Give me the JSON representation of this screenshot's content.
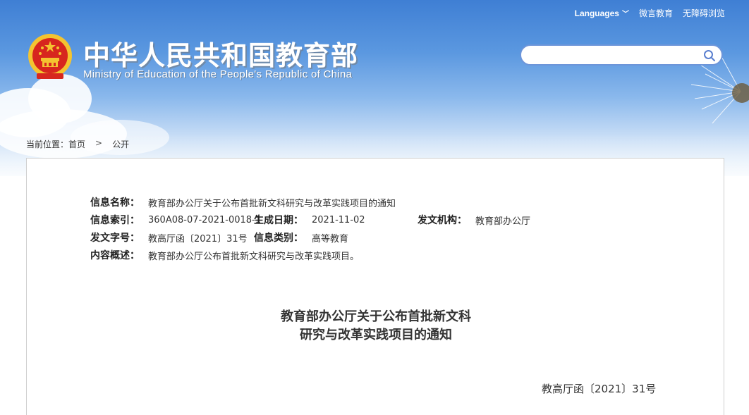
{
  "header": {
    "title_cn": "中华人民共和国教育部",
    "title_en": "Ministry of Education of the People's Republic of China",
    "links": {
      "languages": "Languages",
      "weiyan": "微言教育",
      "accessible": "无障碍浏览"
    },
    "search": {
      "placeholder": "",
      "value": ""
    }
  },
  "breadcrumb": {
    "prefix": "当前位置：",
    "home": "首页",
    "separator": ">",
    "current": "公开"
  },
  "meta": {
    "name_label": "信息名称：",
    "name_value": "教育部办公厅关于公布首批新文科研究与改革实践项目的通知",
    "index_label": "信息索引：",
    "index_value": "360A08-07-2021-0018-1",
    "date_label": "生成日期：",
    "date_value": "2021-11-02",
    "org_label": "发文机构：",
    "org_value": "教育部办公厅",
    "docno_label": "发文字号：",
    "docno_value": "教高厅函〔2021〕31号",
    "category_label": "信息类别：",
    "category_value": "高等教育",
    "summary_label": "内容概述：",
    "summary_value": "教育部办公厅公布首批新文科研究与改革实践项目。"
  },
  "document": {
    "title_line1": "教育部办公厅关于公布首批新文科",
    "title_line2": "研究与改革实践项目的通知",
    "number": "教高厅函〔2021〕31号"
  },
  "colors": {
    "header_blue": "#3f7fd4",
    "search_border": "#6d95d9",
    "emblem_red": "#d7261e",
    "emblem_gold": "#f4c430"
  }
}
